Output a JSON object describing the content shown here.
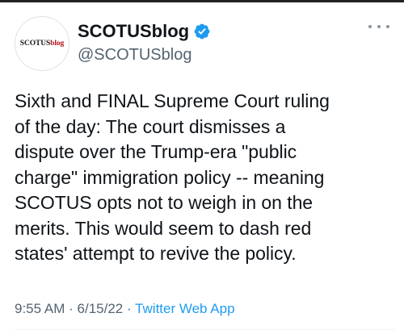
{
  "tweet": {
    "avatar": {
      "text_main": "SCOTUS",
      "text_accent": "blog"
    },
    "display_name": "SCOTUSblog",
    "handle": "@SCOTUSblog",
    "verified": true,
    "text": "Sixth and FINAL Supreme Court ruling\nof the day: The court dismisses a\ndispute over the Trump-era \"public\ncharge\" immigration policy -- meaning\nSCOTUS opts not to weigh in on the\nmerits. This would seem to dash red\nstates' attempt to revive the policy.",
    "time": "9:55 AM",
    "date": "6/15/22",
    "separator": "·",
    "source": "Twitter Web App"
  },
  "colors": {
    "text": "#0f1419",
    "secondary": "#536471",
    "accent": "#1d9bf0",
    "avatar_red": "#b5121b"
  },
  "icons": {
    "verified": "verified-badge-icon",
    "more": "more-options-icon"
  }
}
